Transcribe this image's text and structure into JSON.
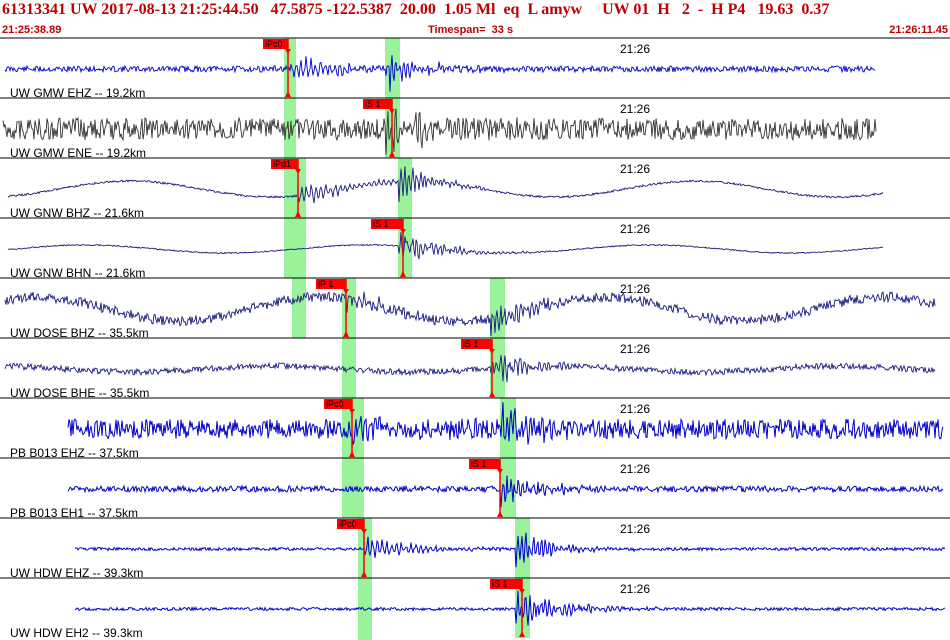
{
  "header": {
    "title": "61313341 UW 2017-08-13 21:25:44.50   47.5875 -122.5387  20.00  1.05 Ml  eq  L amyw     UW 01  H   2  -  H P4   19.63  0.37",
    "start_time": "21:25:38.89",
    "timespan": "Timespan=  33 s",
    "end_time": "21:26:11.45"
  },
  "colors": {
    "header_text": "#c00000",
    "pick_flag": "#ff0000",
    "pick_window": "#9af29a",
    "trace_blue": "#0000cc",
    "trace_gray": "#333333",
    "trace_navy": "#1a1a80",
    "separator": "#000000"
  },
  "time_marker": "21:26",
  "channels": [
    {
      "label": "UW GMW EHZ -- 19.2km",
      "pick": "iPc0",
      "trace_color": "trace_blue"
    },
    {
      "label": "UW GMW ENE -- 19.2km",
      "pick": "iS 1",
      "trace_color": "trace_gray"
    },
    {
      "label": "UW GNW BHZ -- 21.6km",
      "pick": "iPd1",
      "trace_color": "trace_navy"
    },
    {
      "label": "UW GNW BHN -- 21.6km",
      "pick": "iS 1",
      "trace_color": "trace_navy"
    },
    {
      "label": "UW DOSE BHZ -- 35.5km",
      "pick": "iP 1",
      "trace_color": "trace_navy"
    },
    {
      "label": "UW DOSE BHE -- 35.5km",
      "pick": "iS 1",
      "trace_color": "trace_navy"
    },
    {
      "label": "PB B013 EHZ -- 37.5km",
      "pick": "iPc0",
      "trace_color": "trace_blue"
    },
    {
      "label": "PB B013 EH1 -- 37.5km",
      "pick": "iS 1",
      "trace_color": "trace_blue"
    },
    {
      "label": "UW HDW EHZ -- 39.3km",
      "pick": "iPc0",
      "trace_color": "trace_blue"
    },
    {
      "label": "UW HDW EH2 -- 39.3km",
      "pick": "iS 1",
      "trace_color": "trace_blue"
    }
  ]
}
